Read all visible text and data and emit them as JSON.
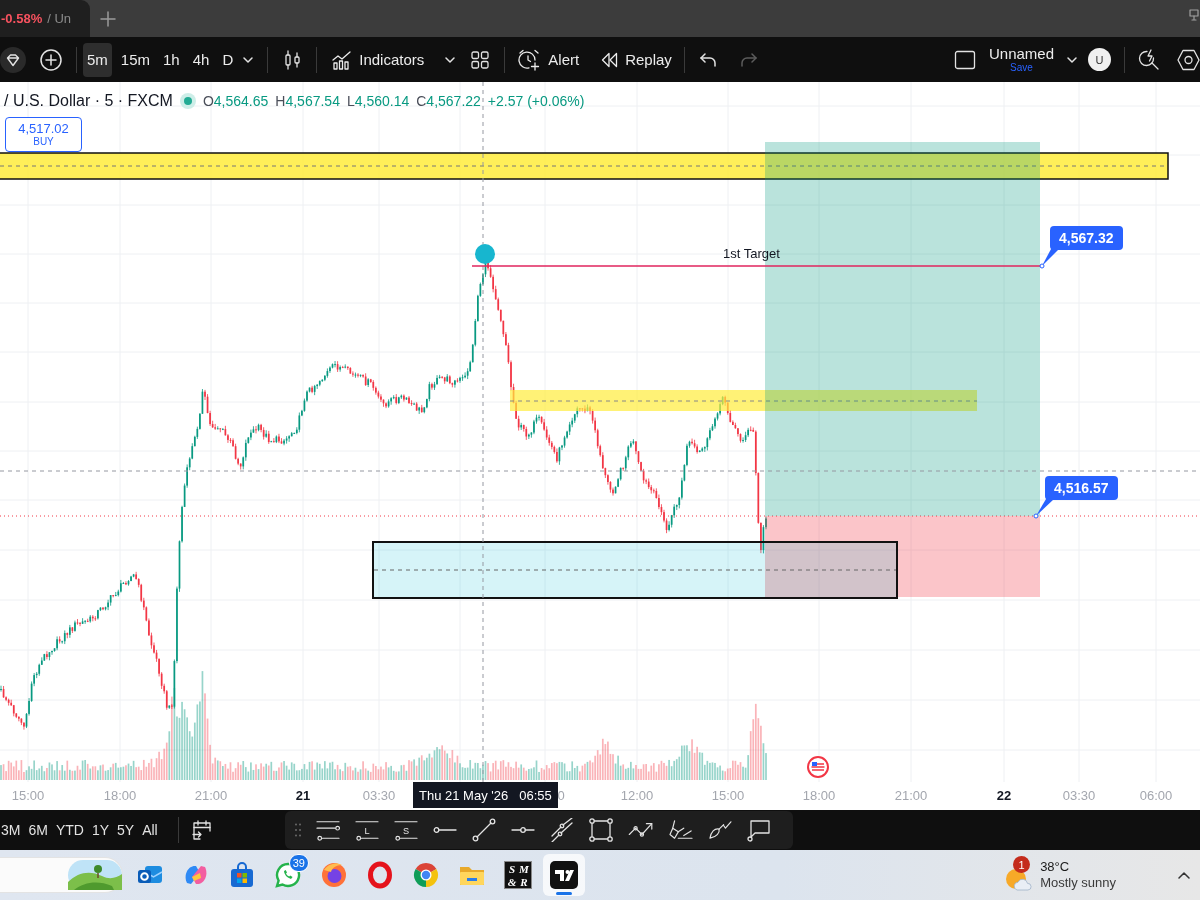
{
  "browser_tab": {
    "change": "-0.58%",
    "title": "/ Un"
  },
  "toolbar": {
    "intervals": [
      {
        "label": "5m",
        "selected": true
      },
      {
        "label": "15m",
        "selected": false
      },
      {
        "label": "1h",
        "selected": false
      },
      {
        "label": "4h",
        "selected": false
      },
      {
        "label": "D",
        "selected": false
      }
    ],
    "indicators": "Indicators",
    "alert": "Alert",
    "replay": "Replay",
    "undo": {
      "disabled": false
    },
    "redo": {
      "disabled": true
    },
    "layout": {
      "name": "Unnamed",
      "action": "Save"
    },
    "avatar": "U"
  },
  "legend": {
    "symbol": "/ U.S. Dollar · 5 · FXCM",
    "values": [
      {
        "key": "O",
        "value": "4,564.65"
      },
      {
        "key": "H",
        "value": "4,567.54"
      },
      {
        "key": "L",
        "value": "4,560.14"
      },
      {
        "key": "C",
        "value": "4,567.22"
      }
    ],
    "change": "+2.57 (+0.06%)"
  },
  "buy_button": {
    "price": "4,517.02",
    "label": "BUY"
  },
  "drawings": {
    "target_label": "1st Target",
    "price_labels": [
      "4,567.32",
      "4,516.57"
    ]
  },
  "time_axis": {
    "labels": [
      {
        "text": "15:00",
        "bold": false
      },
      {
        "text": "18:00",
        "bold": false
      },
      {
        "text": "21:00",
        "bold": false
      },
      {
        "text": "21",
        "bold": true
      },
      {
        "text": "03:30",
        "bold": false
      },
      {
        "text": "0",
        "bold": false
      },
      {
        "text": "12:00",
        "bold": false
      },
      {
        "text": "15:00",
        "bold": false
      },
      {
        "text": "18:00",
        "bold": false
      },
      {
        "text": "21:00",
        "bold": false
      },
      {
        "text": "22",
        "bold": true
      },
      {
        "text": "03:30",
        "bold": false
      },
      {
        "text": "06:00",
        "bold": false
      }
    ],
    "crosshair": {
      "date": "Thu 21 May '26",
      "time": "06:55"
    }
  },
  "range_bar": {
    "ranges": [
      {
        "label": "3M",
        "selected": false
      },
      {
        "label": "6M",
        "selected": false
      },
      {
        "label": "YTD",
        "selected": false
      },
      {
        "label": "1Y",
        "selected": false
      },
      {
        "label": "5Y",
        "selected": false
      },
      {
        "label": "All",
        "selected": false
      }
    ]
  },
  "drawing_toolbar": {
    "letter_tools": [
      "L",
      "S"
    ]
  },
  "taskbar": {
    "apps": [
      {
        "kind": "mail",
        "active": false
      },
      {
        "kind": "swirl",
        "active": false
      },
      {
        "kind": "store",
        "active": false
      },
      {
        "kind": "chat",
        "active": false,
        "badge": "39"
      },
      {
        "kind": "fox",
        "active": false
      },
      {
        "kind": "ring",
        "active": false
      },
      {
        "kind": "pinwheel",
        "active": false
      },
      {
        "kind": "folder",
        "active": false
      },
      {
        "kind": "letters",
        "active": false,
        "letters": [
          "S",
          "M",
          "&",
          "R"
        ]
      },
      {
        "kind": "chart",
        "active": true
      }
    ],
    "weather": {
      "badge": "1",
      "temperature": "38°C",
      "condition": "Mostly sunny"
    }
  }
}
